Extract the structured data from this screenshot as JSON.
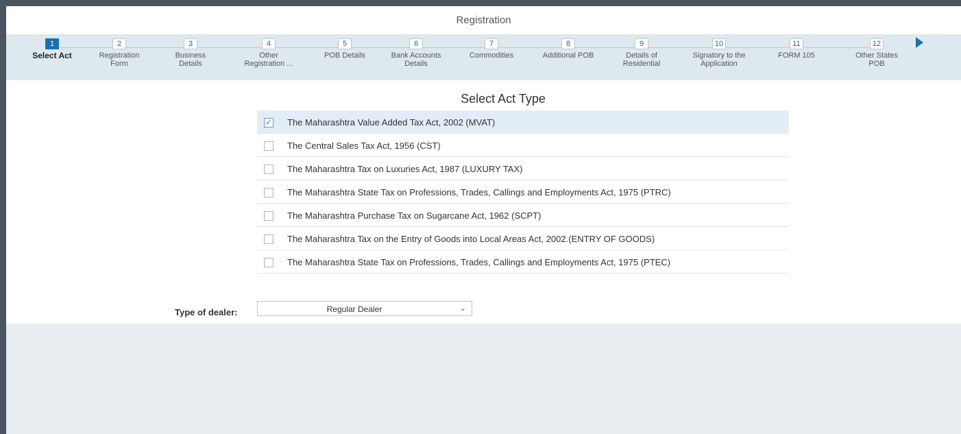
{
  "window": {
    "title": "Registration"
  },
  "steps": [
    {
      "num": "1",
      "label": "Select Act"
    },
    {
      "num": "2",
      "label": "Registration\nForm"
    },
    {
      "num": "3",
      "label": "Business\nDetails"
    },
    {
      "num": "4",
      "label": "Other\nRegistration ..."
    },
    {
      "num": "5",
      "label": "POB Details"
    },
    {
      "num": "6",
      "label": "Bank Accounts\nDetails"
    },
    {
      "num": "7",
      "label": "Commodities"
    },
    {
      "num": "8",
      "label": "Additional POB"
    },
    {
      "num": "9",
      "label": "Details of\nResidential"
    },
    {
      "num": "10",
      "label": "Signatory to the\nApplication"
    },
    {
      "num": "11",
      "label": "FORM 105"
    },
    {
      "num": "12",
      "label": "Other States\nPOB"
    }
  ],
  "active_step": "1",
  "section": {
    "title": "Select Act Type"
  },
  "acts": [
    {
      "label": "The Maharashtra Value Added Tax Act, 2002 (MVAT)",
      "checked": true
    },
    {
      "label": "The Central Sales Tax Act, 1956 (CST)",
      "checked": false
    },
    {
      "label": "The Maharashtra Tax on Luxuries Act, 1987 (LUXURY TAX)",
      "checked": false
    },
    {
      "label": "The Maharashtra State Tax on Professions, Trades, Callings and Employments Act, 1975 (PTRC)",
      "checked": false
    },
    {
      "label": "The Maharashtra Purchase Tax on Sugarcane Act, 1962 (SCPT)",
      "checked": false
    },
    {
      "label": "The Maharashtra Tax on the Entry of Goods into Local Areas Act, 2002.(ENTRY OF GOODS)",
      "checked": false
    },
    {
      "label": "The Maharashtra State Tax on Professions, Trades, Callings and Employments Act, 1975 (PTEC)",
      "checked": false
    }
  ],
  "dealer": {
    "label": "Type of dealer:",
    "value": "Regular Dealer"
  },
  "icons": {
    "check": "✓",
    "chevron": "⌄",
    "next_arrow": "next-arrow-icon"
  },
  "colors": {
    "accent": "#1a6fb3",
    "steps_bg": "#dde9ee",
    "selected_row": "#e3edf7",
    "page_bg": "#e8edf1"
  }
}
